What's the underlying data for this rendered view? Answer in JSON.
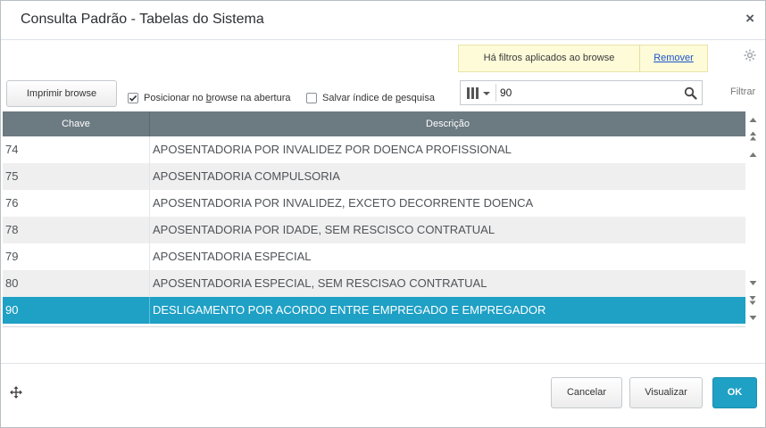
{
  "dialog": {
    "title": "Consulta Padrão - Tabelas do Sistema",
    "close_label": "×"
  },
  "filter_notice": {
    "text": "Há filtros aplicados ao browse",
    "remove_label": "Remover"
  },
  "toolbar": {
    "print_label": "Imprimir browse",
    "position_checkbox": {
      "before": "Posicionar no ",
      "underlined": "b",
      "after": "rowse na abertura",
      "checked": true
    },
    "save_index_checkbox": {
      "before": "Salvar índice de ",
      "underlined": "p",
      "after": "esquisa",
      "checked": false
    }
  },
  "search": {
    "value": "90",
    "filter_label": "Filtrar"
  },
  "grid": {
    "columns": [
      "Chave",
      "Descrição"
    ],
    "rows": [
      {
        "chave": "74",
        "descricao": "APOSENTADORIA POR INVALIDEZ POR DOENCA PROFISSIONAL"
      },
      {
        "chave": "75",
        "descricao": "APOSENTADORIA COMPULSORIA"
      },
      {
        "chave": "76",
        "descricao": "APOSENTADORIA POR INVALIDEZ, EXCETO DECORRENTE DOENCA"
      },
      {
        "chave": "78",
        "descricao": "APOSENTADORIA POR IDADE, SEM RESCISCO CONTRATUAL"
      },
      {
        "chave": "79",
        "descricao": "APOSENTADORIA ESPECIAL"
      },
      {
        "chave": "80",
        "descricao": "APOSENTADORIA ESPECIAL, SEM RESCISAO CONTRATUAL"
      },
      {
        "chave": "90",
        "descricao": "DESLIGAMENTO POR ACORDO ENTRE EMPREGADO E EMPREGADOR"
      }
    ],
    "selected_row": 6
  },
  "footer": {
    "cancel_label": "Cancelar",
    "view_label": "Visualizar",
    "ok_label": "OK"
  },
  "colors": {
    "selection": "#1fa0c5",
    "header": "#6c7a82",
    "filter_bg": "#fdfbd8"
  }
}
